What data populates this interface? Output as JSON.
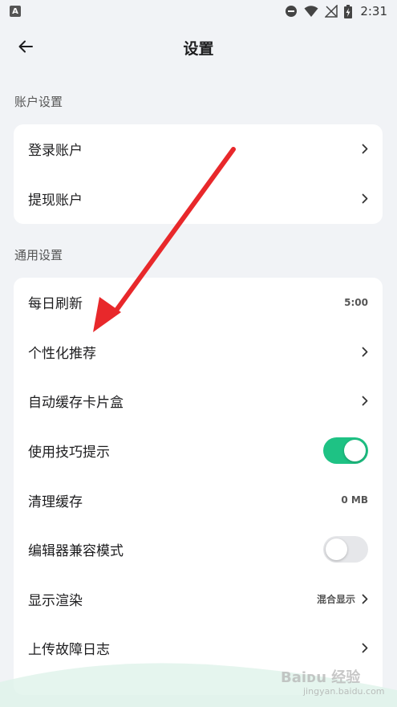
{
  "status_bar": {
    "app_badge": "A",
    "time": "2:31"
  },
  "header": {
    "title": "设置"
  },
  "sections": {
    "account": {
      "label": "账户设置",
      "items": [
        {
          "label": "登录账户"
        },
        {
          "label": "提现账户"
        }
      ]
    },
    "general": {
      "label": "通用设置",
      "items": [
        {
          "label": "每日刷新",
          "value": "5:00"
        },
        {
          "label": "个性化推荐"
        },
        {
          "label": "自动缓存卡片盒"
        },
        {
          "label": "使用技巧提示",
          "toggle": "on"
        },
        {
          "label": "清理缓存",
          "value": "0 MB"
        },
        {
          "label": "编辑器兼容模式",
          "toggle": "off"
        },
        {
          "label": "显示渲染",
          "value": "混合显示"
        },
        {
          "label": "上传故障日志"
        }
      ]
    }
  },
  "colors": {
    "background": "#f1f3f6",
    "toggle_on": "#1ec284",
    "toggle_off": "#e6e7ea",
    "annotation_arrow": "#e8282b"
  },
  "watermark": {
    "main": "Baiᴅu 经验",
    "sub": "jingyan.baidu.com"
  }
}
